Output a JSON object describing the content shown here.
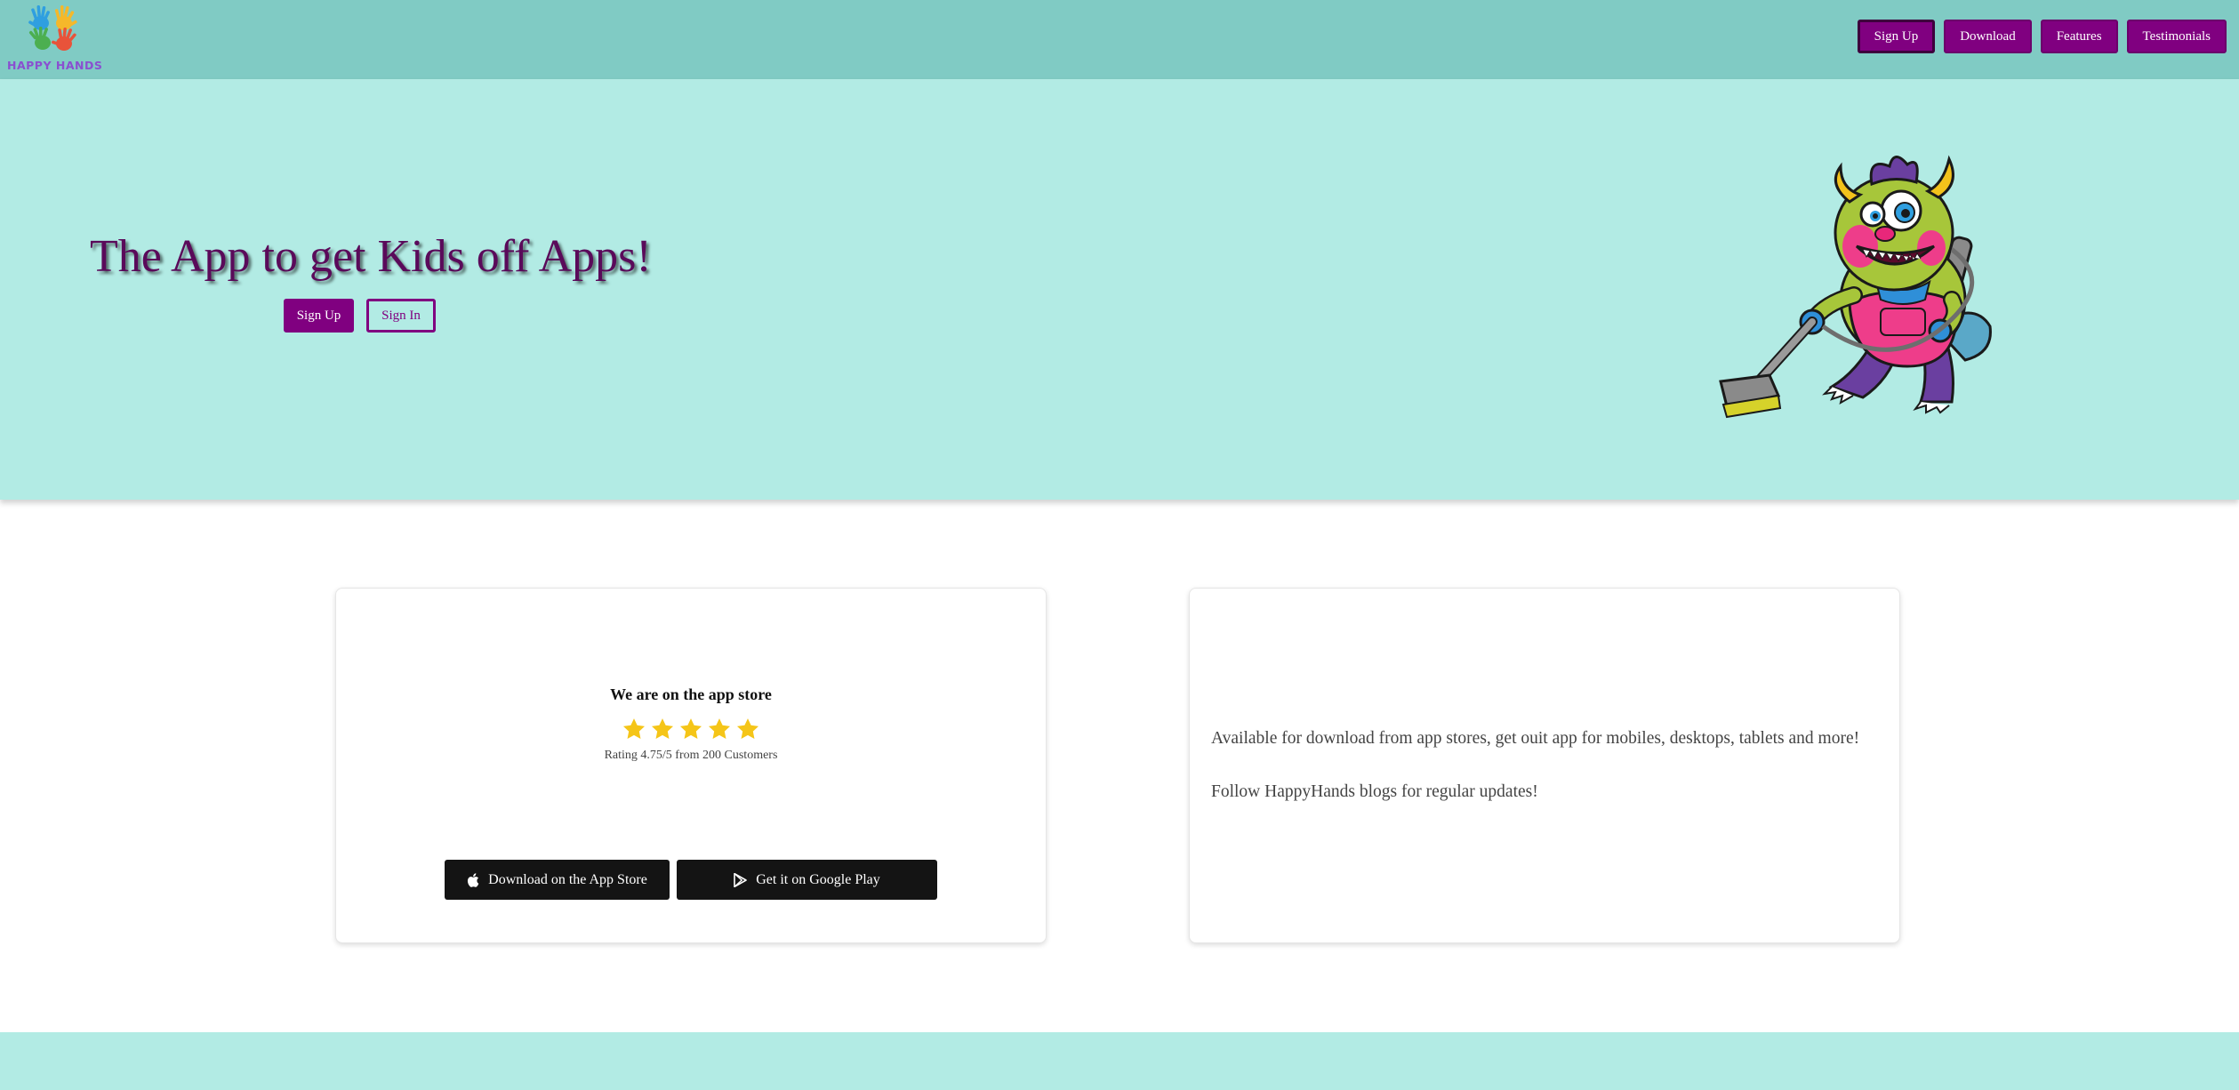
{
  "brand": {
    "name": "HAPPY HANDS"
  },
  "nav": {
    "items": [
      {
        "label": "Sign Up"
      },
      {
        "label": "Download"
      },
      {
        "label": "Features"
      },
      {
        "label": "Testimonials"
      }
    ]
  },
  "hero": {
    "title": "The App to get Kids off Apps!",
    "primary_button": "Sign Up",
    "secondary_button": "Sign In",
    "illustration": "monster-mascot-vacuuming"
  },
  "app_store_card": {
    "heading": "We are on the app store",
    "rating": {
      "stars_shown": 5,
      "text": "Rating 4.75/5 from 200 Customers"
    },
    "buttons": [
      {
        "label": "Download on the App Store",
        "icon": "apple-icon"
      },
      {
        "label": "Get it on Google Play",
        "icon": "google-play-icon"
      }
    ]
  },
  "info_card": {
    "paragraphs": [
      "Available for download from app stores, get ouit app for mobiles, desktops, tablets and more!",
      "Follow HappyHands blogs for regular updates!"
    ]
  },
  "colors": {
    "header_bg": "#80cbc4",
    "hero_bg": "#b2ebe4",
    "accent_purple": "#800080",
    "title_color": "#5a0a5a",
    "star_color": "#f5c518",
    "store_button_bg": "#141414"
  }
}
